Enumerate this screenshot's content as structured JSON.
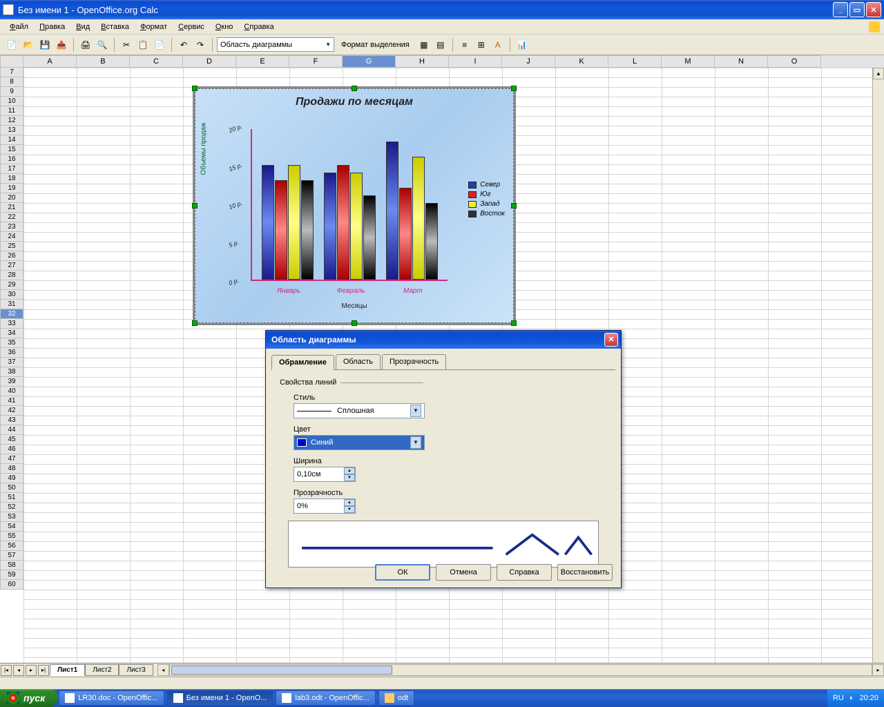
{
  "window": {
    "title": "Без имени 1 - OpenOffice.org Calc"
  },
  "menu": {
    "items": [
      "Файл",
      "Правка",
      "Вид",
      "Вставка",
      "Формат",
      "Сервис",
      "Окно",
      "Справка"
    ]
  },
  "toolbar": {
    "obj_selector": "Область диаграммы",
    "format_sel": "Формат выделения"
  },
  "cols": [
    "A",
    "B",
    "C",
    "D",
    "E",
    "F",
    "G",
    "H",
    "I",
    "J",
    "K",
    "L",
    "M",
    "N",
    "O"
  ],
  "rows": [
    "7",
    "8",
    "9",
    "10",
    "11",
    "12",
    "13",
    "14",
    "15",
    "16",
    "17",
    "18",
    "19",
    "20",
    "21",
    "22",
    "23",
    "24",
    "25",
    "26",
    "27",
    "28",
    "29",
    "30",
    "31",
    "32",
    "33",
    "34",
    "35",
    "36",
    "37",
    "38",
    "39",
    "40",
    "41",
    "42",
    "43",
    "44",
    "45",
    "46",
    "47",
    "48",
    "49",
    "50",
    "51",
    "52",
    "53",
    "54",
    "55",
    "56",
    "57",
    "58",
    "59",
    "60"
  ],
  "selected_col": "G",
  "selected_row": "32",
  "chart_data": {
    "type": "bar",
    "title": "Продажи по месяцам",
    "xlabel": "Месяцы",
    "ylabel": "Объемы продаж",
    "categories": [
      "Январь",
      "Февраль",
      "Март"
    ],
    "series": [
      {
        "name": "Север",
        "color": "#2a3ab0",
        "values": [
          15,
          14,
          18
        ]
      },
      {
        "name": "Юг",
        "color": "#e02020",
        "values": [
          13,
          15,
          12
        ]
      },
      {
        "name": "Запад",
        "color": "#f0f030",
        "values": [
          15,
          14,
          16
        ]
      },
      {
        "name": "Восток",
        "color": "#303030",
        "values": [
          13,
          11,
          10
        ]
      }
    ],
    "y_ticks": [
      "0 р.",
      "5 р.",
      "10 р.",
      "15 р.",
      "20 р."
    ],
    "ylim": [
      0,
      20
    ]
  },
  "dialog": {
    "title": "Область диаграммы",
    "tabs": {
      "t0": "Обрамление",
      "t1": "Область",
      "t2": "Прозрачность"
    },
    "fieldset": "Свойства линий",
    "style_label": "Стиль",
    "style_value": "Сплошная",
    "color_label": "Цвет",
    "color_value": "Синий",
    "width_label": "Ширина",
    "width_value": "0,10см",
    "transp_label": "Прозрачность",
    "transp_value": "0%",
    "ok": "ОК",
    "cancel": "Отмена",
    "help": "Справка",
    "reset": "Восстановить"
  },
  "sheets": {
    "s0": "Лист1",
    "s1": "Лист2",
    "s2": "Лист3"
  },
  "taskbar": {
    "start": "пуск",
    "t0": "LR30.doc - OpenOffic...",
    "t1": "Без имени 1 - OpenO...",
    "t2": "lab3.odt - OpenOffic...",
    "t3": "odt",
    "lang": "RU",
    "time": "20:20"
  }
}
